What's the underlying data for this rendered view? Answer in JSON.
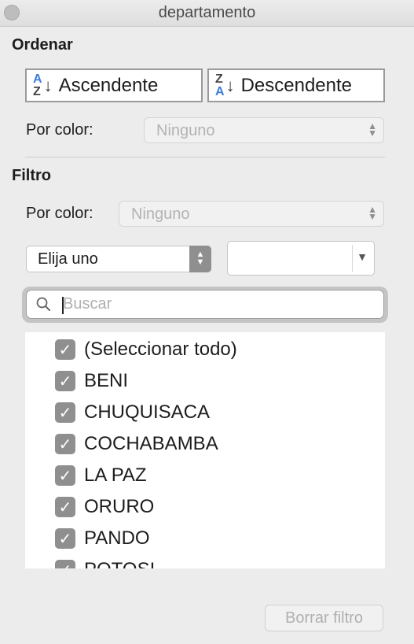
{
  "window": {
    "title": "departamento"
  },
  "sort": {
    "heading": "Ordenar",
    "ascending": {
      "label": "Ascendente",
      "icon_top": "A",
      "icon_bottom": "Z",
      "arrow": "↓"
    },
    "descending": {
      "label": "Descendente",
      "icon_top": "Z",
      "icon_bottom": "A",
      "arrow": "↓"
    },
    "by_color_label": "Por color:",
    "by_color_value": "Ninguno"
  },
  "filter": {
    "heading": "Filtro",
    "by_color_label": "Por color:",
    "by_color_value": "Ninguno",
    "condition_value": "Elija uno",
    "condition_input_value": "",
    "search_placeholder": "Buscar",
    "items": [
      {
        "label": "(Seleccionar todo)",
        "checked": true
      },
      {
        "label": "BENI",
        "checked": true
      },
      {
        "label": "CHUQUISACA",
        "checked": true
      },
      {
        "label": "COCHABAMBA",
        "checked": true
      },
      {
        "label": "LA PAZ",
        "checked": true
      },
      {
        "label": "ORURO",
        "checked": true
      },
      {
        "label": "PANDO",
        "checked": true
      },
      {
        "label": "POTOSI",
        "checked": true
      }
    ],
    "clear_label": "Borrar filtro"
  }
}
